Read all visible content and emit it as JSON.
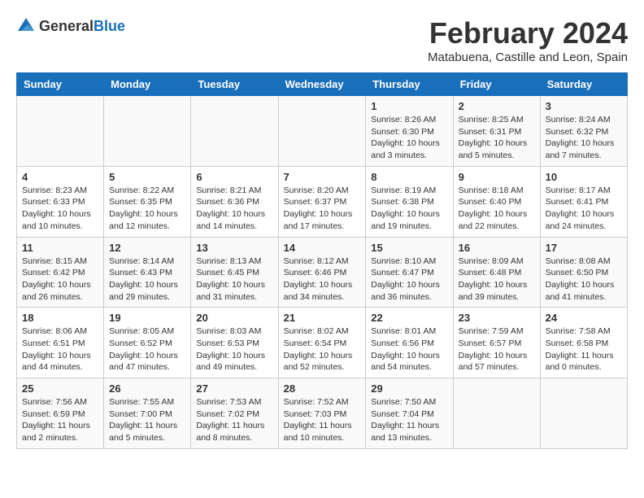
{
  "header": {
    "logo_general": "General",
    "logo_blue": "Blue",
    "month_year": "February 2024",
    "location": "Matabuena, Castille and Leon, Spain"
  },
  "calendar": {
    "days_of_week": [
      "Sunday",
      "Monday",
      "Tuesday",
      "Wednesday",
      "Thursday",
      "Friday",
      "Saturday"
    ],
    "weeks": [
      [
        {
          "day": "",
          "info": ""
        },
        {
          "day": "",
          "info": ""
        },
        {
          "day": "",
          "info": ""
        },
        {
          "day": "",
          "info": ""
        },
        {
          "day": "1",
          "info": "Sunrise: 8:26 AM\nSunset: 6:30 PM\nDaylight: 10 hours and 3 minutes."
        },
        {
          "day": "2",
          "info": "Sunrise: 8:25 AM\nSunset: 6:31 PM\nDaylight: 10 hours and 5 minutes."
        },
        {
          "day": "3",
          "info": "Sunrise: 8:24 AM\nSunset: 6:32 PM\nDaylight: 10 hours and 7 minutes."
        }
      ],
      [
        {
          "day": "4",
          "info": "Sunrise: 8:23 AM\nSunset: 6:33 PM\nDaylight: 10 hours and 10 minutes."
        },
        {
          "day": "5",
          "info": "Sunrise: 8:22 AM\nSunset: 6:35 PM\nDaylight: 10 hours and 12 minutes."
        },
        {
          "day": "6",
          "info": "Sunrise: 8:21 AM\nSunset: 6:36 PM\nDaylight: 10 hours and 14 minutes."
        },
        {
          "day": "7",
          "info": "Sunrise: 8:20 AM\nSunset: 6:37 PM\nDaylight: 10 hours and 17 minutes."
        },
        {
          "day": "8",
          "info": "Sunrise: 8:19 AM\nSunset: 6:38 PM\nDaylight: 10 hours and 19 minutes."
        },
        {
          "day": "9",
          "info": "Sunrise: 8:18 AM\nSunset: 6:40 PM\nDaylight: 10 hours and 22 minutes."
        },
        {
          "day": "10",
          "info": "Sunrise: 8:17 AM\nSunset: 6:41 PM\nDaylight: 10 hours and 24 minutes."
        }
      ],
      [
        {
          "day": "11",
          "info": "Sunrise: 8:15 AM\nSunset: 6:42 PM\nDaylight: 10 hours and 26 minutes."
        },
        {
          "day": "12",
          "info": "Sunrise: 8:14 AM\nSunset: 6:43 PM\nDaylight: 10 hours and 29 minutes."
        },
        {
          "day": "13",
          "info": "Sunrise: 8:13 AM\nSunset: 6:45 PM\nDaylight: 10 hours and 31 minutes."
        },
        {
          "day": "14",
          "info": "Sunrise: 8:12 AM\nSunset: 6:46 PM\nDaylight: 10 hours and 34 minutes."
        },
        {
          "day": "15",
          "info": "Sunrise: 8:10 AM\nSunset: 6:47 PM\nDaylight: 10 hours and 36 minutes."
        },
        {
          "day": "16",
          "info": "Sunrise: 8:09 AM\nSunset: 6:48 PM\nDaylight: 10 hours and 39 minutes."
        },
        {
          "day": "17",
          "info": "Sunrise: 8:08 AM\nSunset: 6:50 PM\nDaylight: 10 hours and 41 minutes."
        }
      ],
      [
        {
          "day": "18",
          "info": "Sunrise: 8:06 AM\nSunset: 6:51 PM\nDaylight: 10 hours and 44 minutes."
        },
        {
          "day": "19",
          "info": "Sunrise: 8:05 AM\nSunset: 6:52 PM\nDaylight: 10 hours and 47 minutes."
        },
        {
          "day": "20",
          "info": "Sunrise: 8:03 AM\nSunset: 6:53 PM\nDaylight: 10 hours and 49 minutes."
        },
        {
          "day": "21",
          "info": "Sunrise: 8:02 AM\nSunset: 6:54 PM\nDaylight: 10 hours and 52 minutes."
        },
        {
          "day": "22",
          "info": "Sunrise: 8:01 AM\nSunset: 6:56 PM\nDaylight: 10 hours and 54 minutes."
        },
        {
          "day": "23",
          "info": "Sunrise: 7:59 AM\nSunset: 6:57 PM\nDaylight: 10 hours and 57 minutes."
        },
        {
          "day": "24",
          "info": "Sunrise: 7:58 AM\nSunset: 6:58 PM\nDaylight: 11 hours and 0 minutes."
        }
      ],
      [
        {
          "day": "25",
          "info": "Sunrise: 7:56 AM\nSunset: 6:59 PM\nDaylight: 11 hours and 2 minutes."
        },
        {
          "day": "26",
          "info": "Sunrise: 7:55 AM\nSunset: 7:00 PM\nDaylight: 11 hours and 5 minutes."
        },
        {
          "day": "27",
          "info": "Sunrise: 7:53 AM\nSunset: 7:02 PM\nDaylight: 11 hours and 8 minutes."
        },
        {
          "day": "28",
          "info": "Sunrise: 7:52 AM\nSunset: 7:03 PM\nDaylight: 11 hours and 10 minutes."
        },
        {
          "day": "29",
          "info": "Sunrise: 7:50 AM\nSunset: 7:04 PM\nDaylight: 11 hours and 13 minutes."
        },
        {
          "day": "",
          "info": ""
        },
        {
          "day": "",
          "info": ""
        }
      ]
    ]
  }
}
